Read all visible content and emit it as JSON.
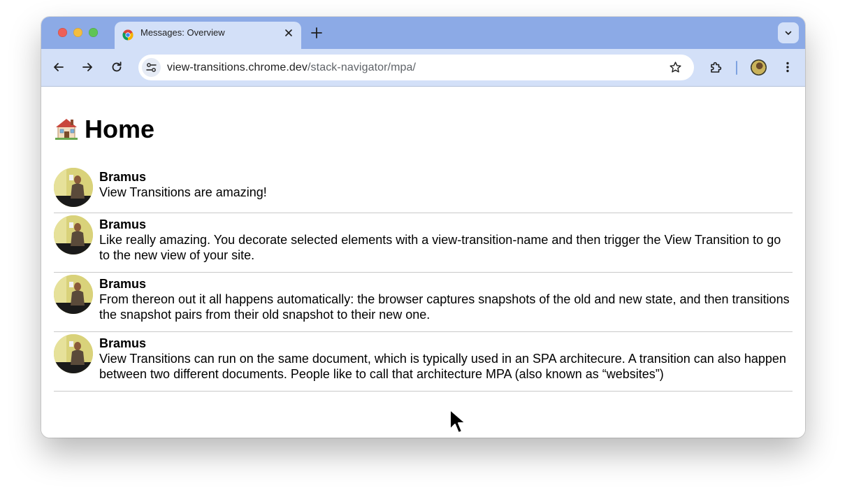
{
  "browser": {
    "tab": {
      "title": "Messages: Overview"
    },
    "address_bar": {
      "host": "view-transitions.chrome.dev",
      "path": "/stack-navigator/mpa/"
    }
  },
  "page": {
    "title_emoji": "🏠",
    "title": "Home",
    "messages": [
      {
        "author": "Bramus",
        "text": "View Transitions are amazing!"
      },
      {
        "author": "Bramus",
        "text": "Like really amazing. You decorate selected elements with a view-transition-name and then trigger the View Transition to go to the new view of your site."
      },
      {
        "author": "Bramus",
        "text": "From thereon out it all happens automatically: the browser captures snapshots of the old and new state, and then transitions the snapshot pairs from their old snapshot to their new one."
      },
      {
        "author": "Bramus",
        "text": "View Transitions can run on the same document, which is typically used in an SPA architecure. A transition can also happen between two different documents. People like to call that architecture MPA (also known as “websites”)"
      }
    ]
  },
  "colors": {
    "tabstrip": "#8caae6",
    "toolbar": "#d3e0f8",
    "page_bg": "#ffffff"
  }
}
